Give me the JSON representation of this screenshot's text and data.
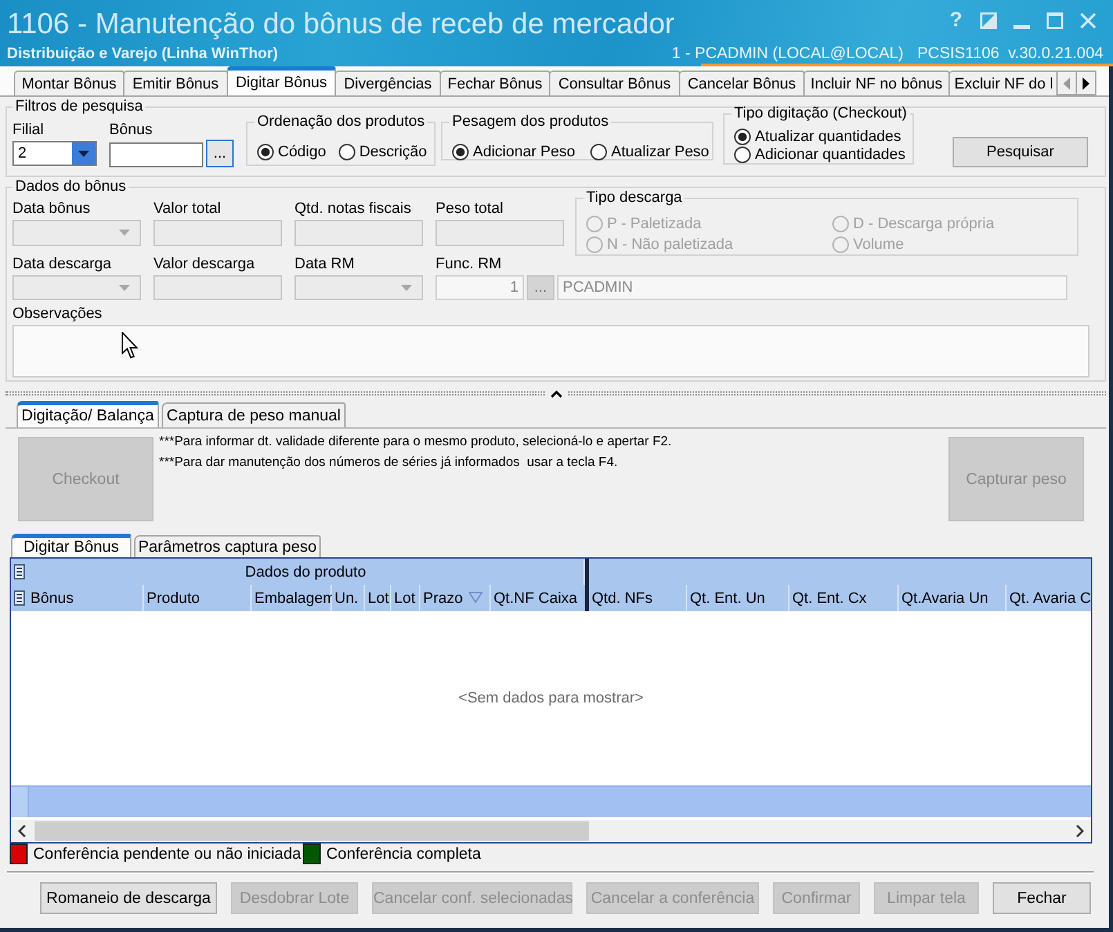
{
  "window": {
    "title": "1106 - Manutenção do bônus de receb de mercador",
    "subtitle": "Distribuição e Varejo (Linha WinThor)",
    "help": "?",
    "session": "1 - PCADMIN (LOCAL@LOCAL)",
    "version": "PCSIS1106  v.30.0.21.004"
  },
  "tabs": [
    {
      "label": "Montar Bônus",
      "selected": false
    },
    {
      "label": "Emitir Bônus",
      "selected": false
    },
    {
      "label": "Digitar Bônus",
      "selected": true
    },
    {
      "label": "Divergências",
      "selected": false
    },
    {
      "label": "Fechar Bônus",
      "selected": false
    },
    {
      "label": "Consultar Bônus",
      "selected": false
    },
    {
      "label": "Cancelar Bônus",
      "selected": false
    },
    {
      "label": "Incluir NF no bônus",
      "selected": false
    },
    {
      "label": "Excluir NF do l",
      "selected": false
    }
  ],
  "search_filters": {
    "title": "Filtros de pesquisa",
    "branch": {
      "label": "Filial",
      "value": "2"
    },
    "bonus": {
      "label": "Bônus",
      "button": "..."
    },
    "ordering": {
      "title": "Ordenação dos produtos",
      "options": [
        {
          "label": "Código",
          "selected": true
        },
        {
          "label": "Descrição",
          "selected": false
        }
      ]
    },
    "weighing": {
      "title": "Pesagem dos produtos",
      "options": [
        {
          "label": "Adicionar Peso",
          "selected": true
        },
        {
          "label": "Atualizar Peso",
          "selected": false
        }
      ]
    },
    "entry_type": {
      "title": "Tipo digitação (Checkout)",
      "options": [
        {
          "label": "Atualizar quantidades",
          "selected": true
        },
        {
          "label": "Adicionar quantidades",
          "selected": false
        }
      ]
    },
    "search_button": "Pesquisar"
  },
  "bonus_data": {
    "title": "Dados do bônus",
    "fields_row_1": [
      {
        "kind": "combo",
        "label": "Data bônus",
        "disabled": true
      },
      {
        "kind": "text",
        "label": "Valor total",
        "disabled": true
      },
      {
        "kind": "text",
        "label": "Qtd. notas fiscais",
        "disabled": true
      },
      {
        "kind": "text",
        "label": "Peso total",
        "disabled": true
      }
    ],
    "unload_type": {
      "title": "Tipo descarga",
      "options": [
        {
          "label": "P - Paletizada",
          "selected": false,
          "disabled": true
        },
        {
          "label": "D - Descarga própria",
          "selected": false,
          "disabled": true
        },
        {
          "label": "N - Não paletizada",
          "selected": false,
          "disabled": true
        },
        {
          "label": "Volume",
          "selected": false,
          "disabled": true
        }
      ]
    },
    "fields_row_2": [
      {
        "kind": "combo",
        "label": "Data descarga",
        "disabled": true
      },
      {
        "kind": "text",
        "label": "Valor descarga",
        "disabled": true
      },
      {
        "kind": "combo",
        "label": "Data RM",
        "disabled": true
      }
    ],
    "employee": {
      "label": "Func. RM",
      "code": "1",
      "button": "...",
      "name": "PCADMIN",
      "disabled": true
    },
    "notes": {
      "label": "Observações"
    }
  },
  "capture_tabs": [
    {
      "label": "Digitação/ Balança",
      "selected": true
    },
    {
      "label": "Captura de peso manual",
      "selected": false
    }
  ],
  "checkout_button": {
    "label": "Checkout",
    "disabled": true
  },
  "hints": [
    "***Para informar dt. validade diferente para o mesmo produto, selecioná-lo e apertar F2.",
    "***Para dar manutenção dos números de séries já informados  usar a tecla F4."
  ],
  "capture_button": {
    "label": "Capturar peso",
    "disabled": true
  },
  "grid_tabs": [
    {
      "label": "Digitar Bônus",
      "selected": true
    },
    {
      "label": "Parâmetros captura peso",
      "selected": false
    }
  ],
  "grid": {
    "band": "Dados do produto",
    "columns_left": [
      {
        "label": "Bônus",
        "filter": false
      },
      {
        "label": "Produto",
        "filter": false
      },
      {
        "label": "Embalagem",
        "filter": false
      },
      {
        "label": "Un.",
        "filter": false
      },
      {
        "label": "Lot",
        "filter": false
      },
      {
        "label": "Lot",
        "filter": false
      },
      {
        "label": "Prazo",
        "filter": true
      },
      {
        "label": "Qt.NF Caixa",
        "filter": false
      }
    ],
    "columns_right": [
      {
        "label": "Qtd. NFs",
        "filter": false
      },
      {
        "label": "Qt. Ent. Un",
        "filter": false
      },
      {
        "label": "Qt. Ent. Cx",
        "filter": false
      },
      {
        "label": "Qt.Avaria Un",
        "filter": false
      },
      {
        "label": "Qt. Avaria C",
        "filter": false
      }
    ],
    "empty_text": "<Sem dados para mostrar>"
  },
  "legend": [
    {
      "label": "Conferência pendente ou não iniciada",
      "color": "#d90000"
    },
    {
      "label": "Conferência completa",
      "color": "#005800"
    }
  ],
  "buttons": [
    {
      "label": "Romaneio de descarga",
      "disabled": false
    },
    {
      "label": "Desdobrar Lote",
      "disabled": true
    },
    {
      "label": "Cancelar conf. selecionadas",
      "disabled": true
    },
    {
      "label": "Cancelar a conferência",
      "disabled": true
    },
    {
      "label": "Confirmar",
      "disabled": true
    },
    {
      "label": "Limpar tela",
      "disabled": true
    },
    {
      "label": "Fechar",
      "disabled": false
    }
  ]
}
